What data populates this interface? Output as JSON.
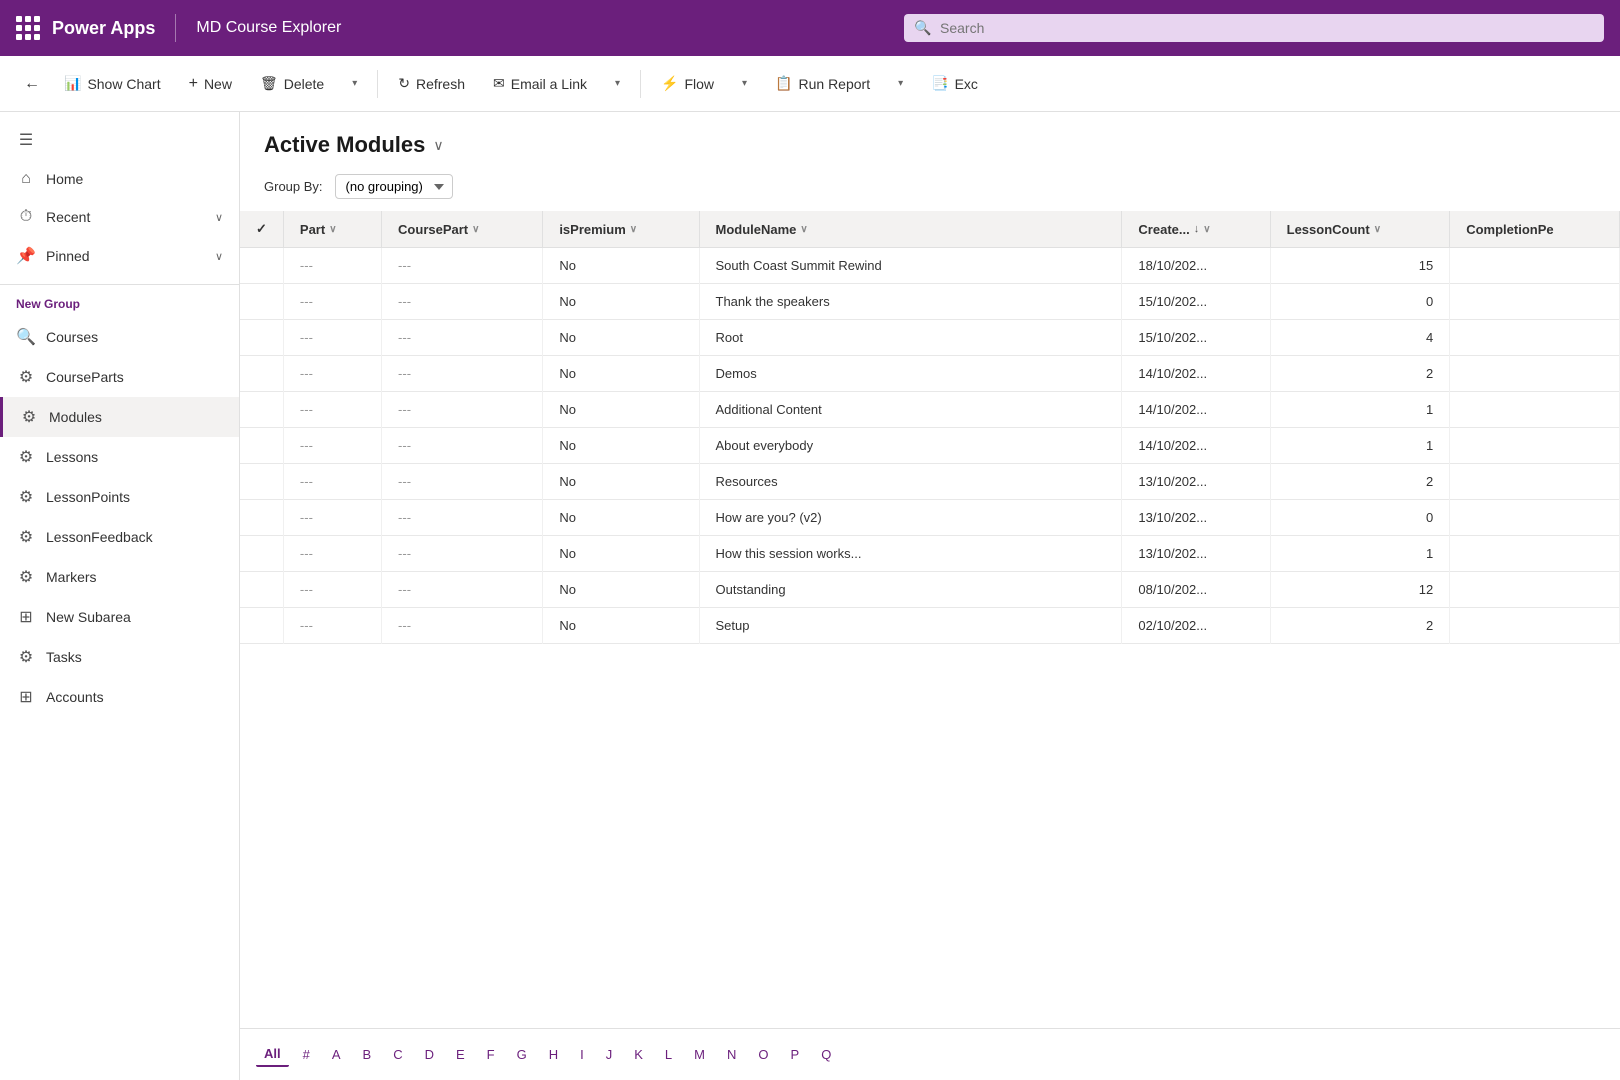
{
  "header": {
    "grid_icon": "apps",
    "app_name": "Power Apps",
    "app_title": "MD Course Explorer",
    "search_placeholder": "Search"
  },
  "toolbar": {
    "back_label": "←",
    "show_chart_label": "Show Chart",
    "new_label": "New",
    "delete_label": "Delete",
    "refresh_label": "Refresh",
    "email_link_label": "Email a Link",
    "flow_label": "Flow",
    "run_report_label": "Run Report",
    "export_label": "Exc"
  },
  "sidebar": {
    "top_items": [
      {
        "id": "hamburger",
        "icon": "☰",
        "label": ""
      },
      {
        "id": "home",
        "icon": "⌂",
        "label": "Home"
      },
      {
        "id": "recent",
        "icon": "⏱",
        "label": "Recent",
        "caret": "∨"
      },
      {
        "id": "pinned",
        "icon": "📌",
        "label": "Pinned",
        "caret": "∨"
      }
    ],
    "group_label": "New Group",
    "nav_items": [
      {
        "id": "courses",
        "icon": "🔍",
        "label": "Courses"
      },
      {
        "id": "courseparts",
        "icon": "⚙",
        "label": "CourseParts"
      },
      {
        "id": "modules",
        "icon": "⚙",
        "label": "Modules",
        "active": true
      },
      {
        "id": "lessons",
        "icon": "⚙",
        "label": "Lessons"
      },
      {
        "id": "lessonpoints",
        "icon": "⚙",
        "label": "LessonPoints"
      },
      {
        "id": "lessonfeedback",
        "icon": "⚙",
        "label": "LessonFeedback"
      },
      {
        "id": "markers",
        "icon": "⚙",
        "label": "Markers"
      },
      {
        "id": "newsubarea",
        "icon": "⊞",
        "label": "New Subarea"
      },
      {
        "id": "tasks",
        "icon": "⚙",
        "label": "Tasks"
      },
      {
        "id": "accounts",
        "icon": "⊞",
        "label": "Accounts"
      }
    ]
  },
  "content": {
    "title": "Active Modules",
    "group_by_label": "Group By:",
    "group_by_value": "(no grouping)",
    "columns": [
      {
        "id": "check",
        "label": "✓"
      },
      {
        "id": "part",
        "label": "Part",
        "sortable": true
      },
      {
        "id": "coursepart",
        "label": "CoursePart",
        "sortable": true
      },
      {
        "id": "ispremium",
        "label": "isPremium",
        "sortable": true
      },
      {
        "id": "modulename",
        "label": "ModuleName",
        "sortable": true
      },
      {
        "id": "created",
        "label": "Create...",
        "sortable": true,
        "sorted": true
      },
      {
        "id": "lessoncount",
        "label": "LessonCount",
        "sortable": true
      },
      {
        "id": "completionpe",
        "label": "CompletionPe",
        "sortable": false
      }
    ],
    "rows": [
      {
        "part": "---",
        "coursepart": "---",
        "ispremium": "No",
        "modulename": "South Coast Summit Rewind",
        "created": "18/10/202...",
        "lessoncount": "15",
        "completionpe": ""
      },
      {
        "part": "---",
        "coursepart": "---",
        "ispremium": "No",
        "modulename": "Thank the speakers",
        "created": "15/10/202...",
        "lessoncount": "0",
        "completionpe": ""
      },
      {
        "part": "---",
        "coursepart": "---",
        "ispremium": "No",
        "modulename": "Root",
        "created": "15/10/202...",
        "lessoncount": "4",
        "completionpe": ""
      },
      {
        "part": "---",
        "coursepart": "---",
        "ispremium": "No",
        "modulename": "Demos",
        "created": "14/10/202...",
        "lessoncount": "2",
        "completionpe": ""
      },
      {
        "part": "---",
        "coursepart": "---",
        "ispremium": "No",
        "modulename": "Additional Content",
        "created": "14/10/202...",
        "lessoncount": "1",
        "completionpe": ""
      },
      {
        "part": "---",
        "coursepart": "---",
        "ispremium": "No",
        "modulename": "About everybody",
        "created": "14/10/202...",
        "lessoncount": "1",
        "completionpe": ""
      },
      {
        "part": "---",
        "coursepart": "---",
        "ispremium": "No",
        "modulename": "Resources",
        "created": "13/10/202...",
        "lessoncount": "2",
        "completionpe": ""
      },
      {
        "part": "---",
        "coursepart": "---",
        "ispremium": "No",
        "modulename": "How are you? (v2)",
        "created": "13/10/202...",
        "lessoncount": "0",
        "completionpe": ""
      },
      {
        "part": "---",
        "coursepart": "---",
        "ispremium": "No",
        "modulename": "How this session works...",
        "created": "13/10/202...",
        "lessoncount": "1",
        "completionpe": ""
      },
      {
        "part": "---",
        "coursepart": "---",
        "ispremium": "No",
        "modulename": "Outstanding",
        "created": "08/10/202...",
        "lessoncount": "12",
        "completionpe": ""
      },
      {
        "part": "---",
        "coursepart": "---",
        "ispremium": "No",
        "modulename": "Setup",
        "created": "02/10/202...",
        "lessoncount": "2",
        "completionpe": ""
      }
    ]
  },
  "pagination": {
    "items": [
      "All",
      "#",
      "A",
      "B",
      "C",
      "D",
      "E",
      "F",
      "G",
      "H",
      "I",
      "J",
      "K",
      "L",
      "M",
      "N",
      "O",
      "P",
      "Q"
    ],
    "active": "All"
  },
  "colors": {
    "brand_purple": "#6b1f7c",
    "active_border": "#6b1f7c"
  }
}
